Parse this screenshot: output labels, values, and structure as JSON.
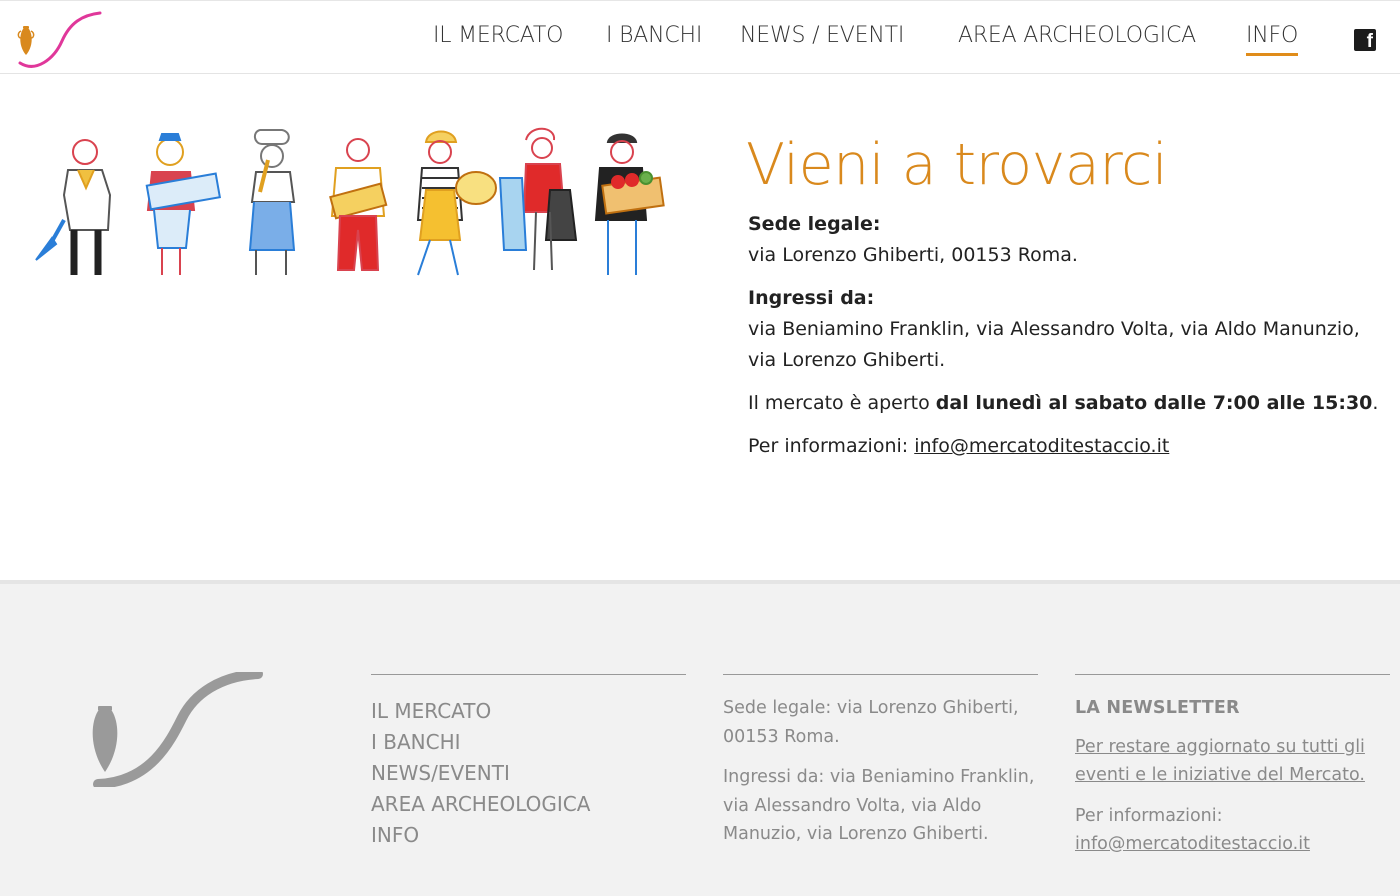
{
  "header": {
    "nav": [
      {
        "label": "IL MERCATO",
        "active": false
      },
      {
        "label": "I BANCHI",
        "active": false
      },
      {
        "label": "NEWS / EVENTI",
        "active": false
      },
      {
        "label": "AREA ARCHEOLOGICA",
        "active": false
      },
      {
        "label": "INFO",
        "active": true
      }
    ],
    "social_icon": "facebook-icon",
    "accent_color": "#e08c1a",
    "logo_curve_color": "#e0379a"
  },
  "info": {
    "title": "Vieni a trovarci",
    "sede_label": "Sede legale:",
    "sede_address": "via Lorenzo Ghiberti, 00153 Roma.",
    "ingressi_label": "Ingressi da:",
    "ingressi_text": "via Beniamino Franklin, via Alessandro Volta, via Aldo Manunzio, via Lorenzo Ghiberti.",
    "hours_prefix": "Il mercato è aperto ",
    "hours_bold": "dal lunedì al sabato dalle 7:00 alle 15:30",
    "hours_suffix": ".",
    "contact_prefix": "Per informazioni: ",
    "contact_email": "info@mercatoditestaccio.it",
    "title_color": "#d9891d"
  },
  "footer": {
    "nav": [
      "IL MERCATO",
      "I BANCHI",
      "NEWS/EVENTI",
      "AREA ARCHEOLOGICA",
      "INFO"
    ],
    "sede": "Sede legale: via Lorenzo Ghiberti, 00153 Roma.",
    "ingressi": "Ingressi da: via Beniamino Franklin, via Alessandro Volta, via Aldo Manuzio, via Lorenzo Ghiberti.",
    "newsletter_title": "LA NEWSLETTER",
    "newsletter_link": "Per restare aggiornato su tutti gli eventi e le iniziative del Mercato.",
    "contact_label": "Per informazioni:",
    "contact_email": "info@mercatoditestaccio.it"
  }
}
